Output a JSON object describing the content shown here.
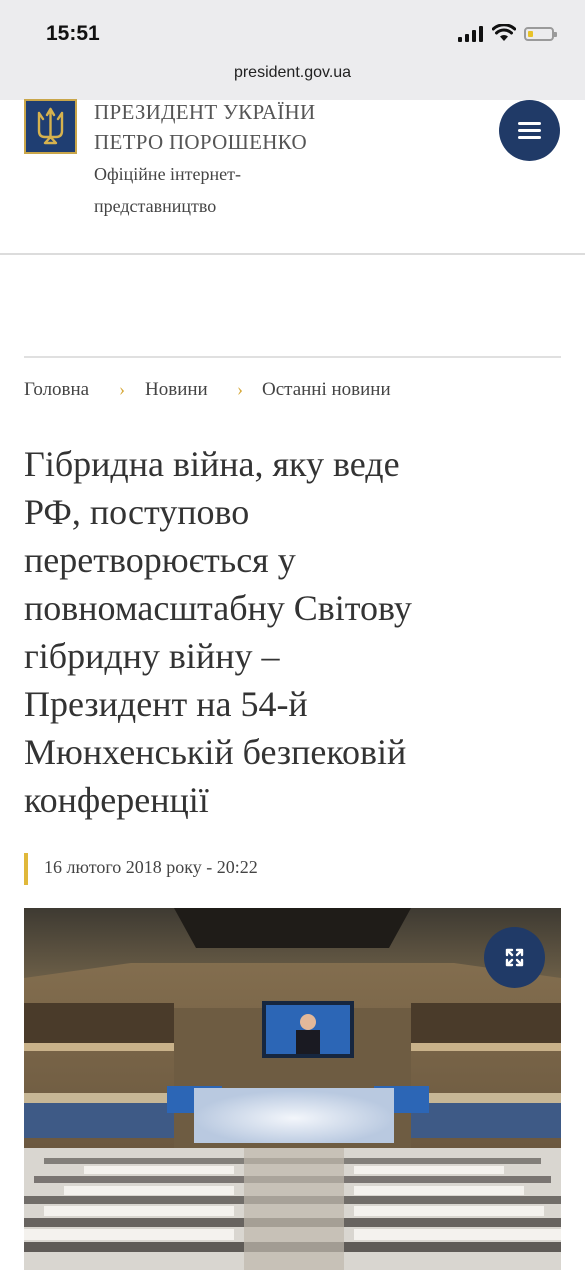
{
  "status_bar": {
    "time": "15:51",
    "url": "president.gov.ua",
    "icons": [
      "signal-icon",
      "wifi-icon",
      "battery-icon"
    ]
  },
  "header": {
    "title_line1": "ПРЕЗИДЕНТ УКРАЇНИ",
    "title_line2": "ПЕТРО ПОРОШЕНКО",
    "subtitle_line1": "Офіційне інтернет-",
    "subtitle_line2": "представництво",
    "logo_icon": "trident-emblem-icon",
    "menu_icon": "hamburger-menu-icon"
  },
  "breadcrumb": {
    "items": [
      "Головна",
      "Новини",
      "Останні новини"
    ],
    "separator": "›"
  },
  "article": {
    "headline_lines": [
      "Гібридна війна, яку веде",
      "РФ, поступово",
      "перетворюється у",
      "повномасштабну Світову",
      "гібридну війну –",
      "Президент на 54-й",
      "Мюнхенській безпековій",
      "конференції"
    ],
    "date": "16 лютого 2018 року - 20:22",
    "expand_icon": "expand-icon"
  },
  "colors": {
    "navy": "#203a67",
    "gold_accent": "#e0b83a",
    "status_bar_bg": "#ececee"
  }
}
